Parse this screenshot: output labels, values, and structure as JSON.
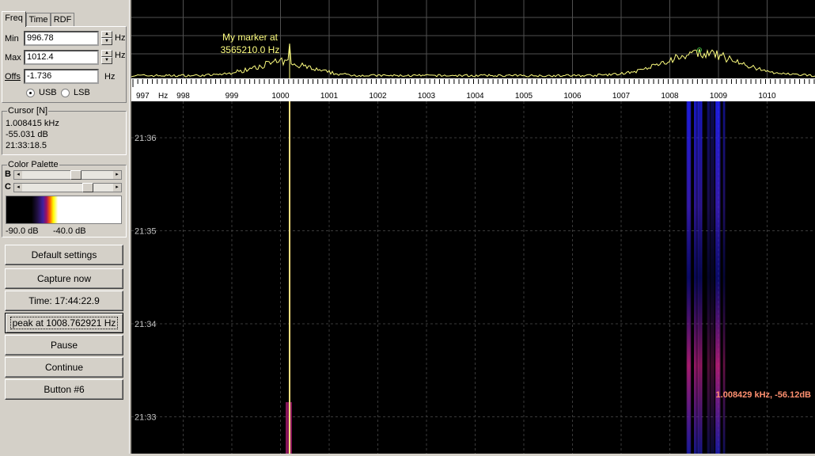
{
  "tabs": [
    {
      "label": "Freq",
      "active": true
    },
    {
      "label": "Time",
      "active": false
    },
    {
      "label": "RDF",
      "active": false
    }
  ],
  "freq": {
    "min_label": "Min",
    "min_value": "996.78",
    "min_unit": "Hz",
    "max_label": "Max",
    "max_value": "1012.4",
    "max_unit": "Hz",
    "offs_label": "Offs",
    "offs_value": "-1.736",
    "offs_unit": "Hz",
    "usb_label": "USB",
    "lsb_label": "LSB",
    "selected_mode": "USB"
  },
  "cursor": {
    "title": "Cursor [N]",
    "frequency": "1.008415 kHz",
    "level": "-55.031 dB",
    "time": "21:33:18.5"
  },
  "palette": {
    "title": "Color Palette",
    "b_label": "B",
    "c_label": "C",
    "b_value": 0.6,
    "c_value": 0.75,
    "min_label": "-90.0 dB",
    "max_label": "-40.0 dB"
  },
  "buttons": [
    {
      "label": "Default settings",
      "name": "default-settings-button"
    },
    {
      "label": "Capture now",
      "name": "capture-now-button"
    },
    {
      "label": "Time:  17:44:22.9",
      "name": "time-button"
    },
    {
      "label": "peak at 1008.762921 Hz",
      "name": "peak-button"
    },
    {
      "label": "Pause",
      "name": "pause-button"
    },
    {
      "label": "Continue",
      "name": "continue-button"
    },
    {
      "label": "Button #6",
      "name": "button-6"
    }
  ],
  "spectrum": {
    "marker_line1": "My marker at",
    "marker_line2": "3565210.0 Hz",
    "axis_unit": "Hz",
    "tick_labels": [
      "997",
      "998",
      "999",
      "1000",
      "1001",
      "1002",
      "1003",
      "1004",
      "1005",
      "1006",
      "1007",
      "1008",
      "1009",
      "1010"
    ],
    "freq_range": [
      996.78,
      1012.4
    ]
  },
  "waterfall": {
    "time_labels": [
      "21:36",
      "21:35",
      "21:34",
      "21:33"
    ],
    "readout": "1.008429 kHz, -56.12dB"
  },
  "colors": {
    "trace": "#ffff80",
    "readout": "#ff9070",
    "grid": "#505050"
  }
}
